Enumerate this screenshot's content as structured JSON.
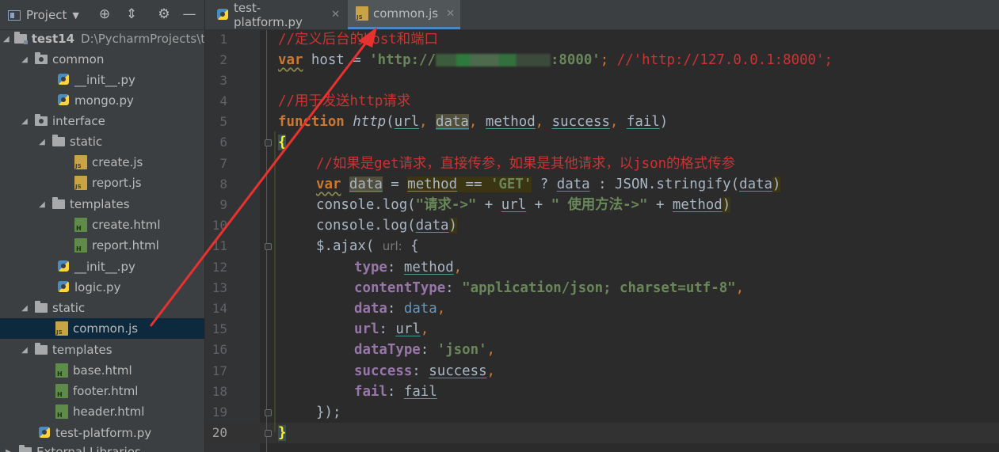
{
  "sidebar": {
    "header": {
      "title": "Project"
    },
    "tree": [
      {
        "label": "test14",
        "path": "D:\\PycharmProjects\\te"
      },
      {
        "label": "common"
      },
      {
        "label": "__init__.py"
      },
      {
        "label": "mongo.py"
      },
      {
        "label": "interface"
      },
      {
        "label": "static"
      },
      {
        "label": "create.js"
      },
      {
        "label": "report.js"
      },
      {
        "label": "templates"
      },
      {
        "label": "create.html"
      },
      {
        "label": "report.html"
      },
      {
        "label": "__init__.py"
      },
      {
        "label": "logic.py"
      },
      {
        "label": "static"
      },
      {
        "label": "common.js"
      },
      {
        "label": "templates"
      },
      {
        "label": "base.html"
      },
      {
        "label": "footer.html"
      },
      {
        "label": "header.html"
      },
      {
        "label": "test-platform.py"
      },
      {
        "label": "External Libraries"
      }
    ]
  },
  "tabs": [
    {
      "label": "test-platform.py",
      "active": false
    },
    {
      "label": "common.js",
      "active": true
    }
  ],
  "editor": {
    "current_line": 20,
    "line_numbers": [
      "1",
      "2",
      "3",
      "4",
      "5",
      "6",
      "7",
      "8",
      "9",
      "10",
      "11",
      "12",
      "13",
      "14",
      "15",
      "16",
      "17",
      "18",
      "19",
      "20"
    ],
    "code": {
      "l1": "//定义后台的host和端口",
      "l2_var": "var",
      "l2_host": " host = ",
      "l2_str_a": "'http://",
      "l2_str_b": ":8000'",
      "l2_semi": "; ",
      "l2_comment": "//'http://127.0.0.1:8000';",
      "l4": "//用于发送http请求",
      "l5_function": "function",
      "l5_name": "http",
      "l5_p1": "url",
      "l5_p2": "data",
      "l5_p3": "method",
      "l5_p4": "success",
      "l5_p5": "fail",
      "l7": "//如果是get请求，直接传参，如果是其他请求，以json的格式传参",
      "l8_var": "var",
      "l8_data": "data",
      "l8_method": "method",
      "l8_get": "'GET'",
      "l8_data2": "data",
      "l8_json": "JSON.stringify(",
      "l8_data3": "data",
      "l9_console": "console.log(",
      "l9_str1": "\"请求->\"",
      "l9_url": "url",
      "l9_str2": "\" 使用方法->\"",
      "l9_method": "method",
      "l10_console": "console.log(",
      "l10_data": "data",
      "l11_ajax": "$.ajax(",
      "l11_hint": "url:",
      "l12_key": "type",
      "l12_val": "method",
      "l13_key": "contentType",
      "l13_val": "\"application/json; charset=utf-8\"",
      "l14_key": "data",
      "l14_val": "data",
      "l15_key": "url",
      "l15_val": "url",
      "l16_key": "dataType",
      "l16_val": "'json'",
      "l17_key": "success",
      "l17_val": "success",
      "l18_key": "fail",
      "l18_val": "fail",
      "l19": "});",
      "l20": "}"
    }
  },
  "colors": {
    "comment": "#cc3333",
    "keyword": "#cc7832",
    "string": "#6a8759",
    "property": "#9876aa",
    "arrow": "#e8322f",
    "selection": "#0d293e"
  }
}
